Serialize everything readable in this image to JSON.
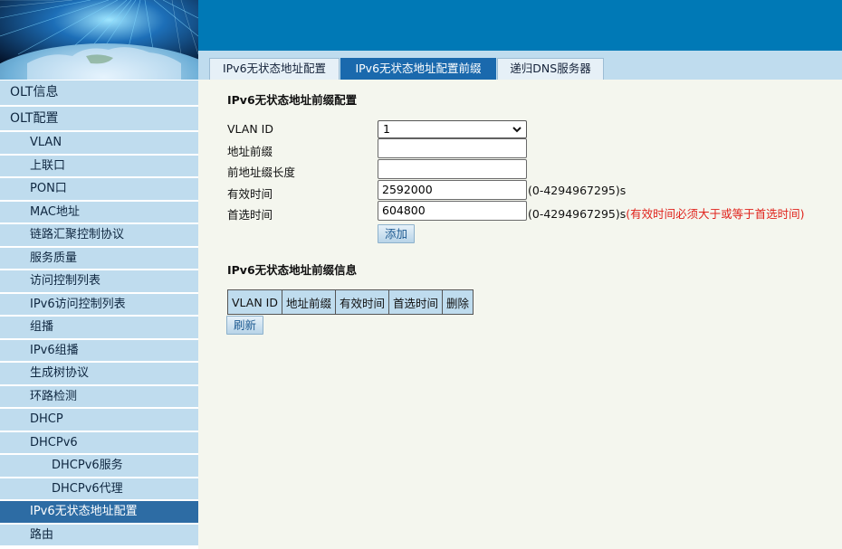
{
  "tabs": [
    {
      "label": "IPv6无状态地址配置",
      "active": false
    },
    {
      "label": "IPv6无状态地址配置前缀",
      "active": true
    },
    {
      "label": "递归DNS服务器",
      "active": false
    }
  ],
  "sidebar": {
    "items": [
      {
        "label": "OLT信息",
        "level": 0
      },
      {
        "label": "OLT配置",
        "level": 0
      },
      {
        "label": "VLAN",
        "level": 1
      },
      {
        "label": "上联口",
        "level": 1
      },
      {
        "label": "PON口",
        "level": 1
      },
      {
        "label": "MAC地址",
        "level": 1
      },
      {
        "label": "链路汇聚控制协议",
        "level": 1
      },
      {
        "label": "服务质量",
        "level": 1
      },
      {
        "label": "访问控制列表",
        "level": 1
      },
      {
        "label": "IPv6访问控制列表",
        "level": 1
      },
      {
        "label": "组播",
        "level": 1
      },
      {
        "label": "IPv6组播",
        "level": 1
      },
      {
        "label": "生成树协议",
        "level": 1
      },
      {
        "label": "环路检测",
        "level": 1
      },
      {
        "label": "DHCP",
        "level": 1
      },
      {
        "label": "DHCPv6",
        "level": 1
      },
      {
        "label": "DHCPv6服务",
        "level": 2
      },
      {
        "label": "DHCPv6代理",
        "level": 2
      },
      {
        "label": "IPv6无状态地址配置",
        "level": 1,
        "active": true
      },
      {
        "label": "路由",
        "level": 1
      }
    ]
  },
  "form": {
    "title": "IPv6无状态地址前缀配置",
    "vlan_id_label": "VLAN ID",
    "vlan_id_value": "1",
    "prefix_label": "地址前缀",
    "prefix_value": "",
    "prefix_len_label": "前地址缀长度",
    "prefix_len_value": "",
    "valid_time_label": "有效时间",
    "valid_time_value": "2592000",
    "valid_time_range": "(0-4294967295)s",
    "preferred_time_label": "首选时间",
    "preferred_time_value": "604800",
    "preferred_time_range": "(0-4294967295)s",
    "preferred_time_warning": "(有效时间必须大于或等于首选时间)",
    "add_button": "添加"
  },
  "info": {
    "title": "IPv6无状态地址前缀信息",
    "columns": [
      "VLAN ID",
      "地址前缀",
      "有效时间",
      "首选时间",
      "删除"
    ],
    "refresh_button": "刷新"
  },
  "colors": {
    "banner_blue": "#0079b6",
    "tab_active": "#1a69ad",
    "sidebar_bg": "#bfdcee",
    "sidebar_active": "#2d6ca4",
    "warning": "#e0231c"
  }
}
